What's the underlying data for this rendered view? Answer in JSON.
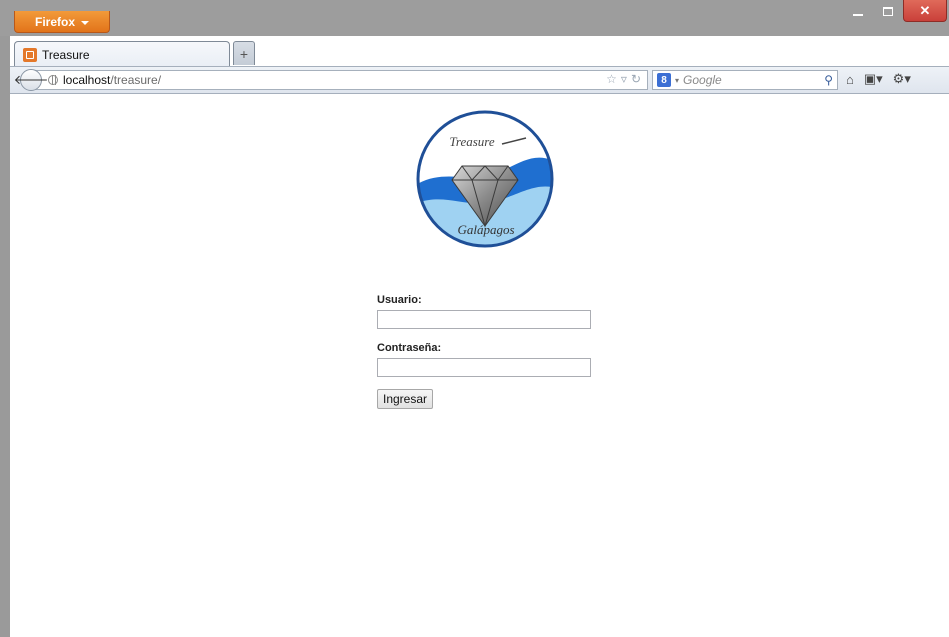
{
  "browser": {
    "menu_button_label": "Firefox",
    "window_controls": {
      "close_label": "✕"
    }
  },
  "tabs": [
    {
      "title": "Treasure",
      "icon": "page-favicon"
    }
  ],
  "navbar": {
    "url_host": "localhost",
    "url_path": "/treasure/",
    "search_placeholder": "Google",
    "search_engine_icon": "google-icon"
  },
  "page": {
    "logo": {
      "top_text": "Treasure",
      "bottom_text": "Galápagos",
      "colors": {
        "ring": "#1f4f97",
        "wave_dark": "#1f6fd0",
        "wave_light": "#9fd2f2",
        "diamond": "#8c8c8c"
      }
    },
    "form": {
      "username_label": "Usuario:",
      "username_value": "",
      "password_label": "Contraseña:",
      "password_value": "",
      "submit_label": "Ingresar"
    }
  }
}
